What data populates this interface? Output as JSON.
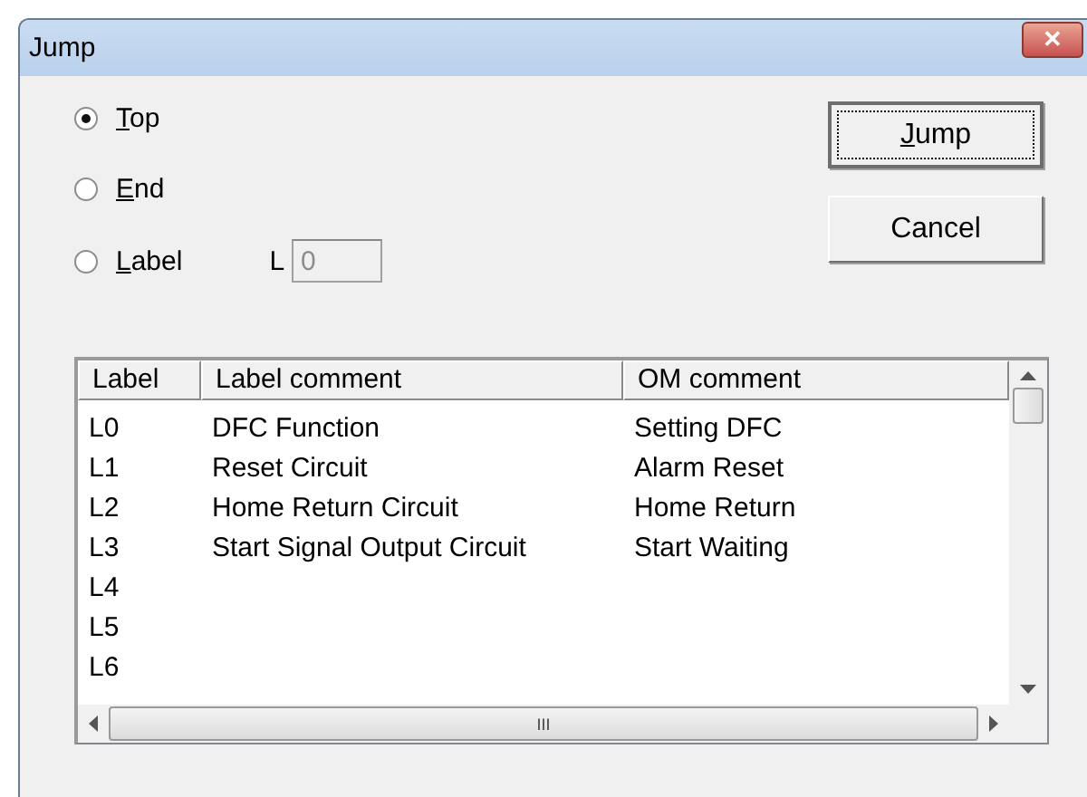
{
  "window": {
    "title": "Jump",
    "close": "✕"
  },
  "options": [
    {
      "label": "Top",
      "mnemonic": true,
      "selected": true
    },
    {
      "label": "End",
      "mnemonic": true,
      "selected": false
    },
    {
      "label": "Label",
      "mnemonic": true,
      "selected": false
    }
  ],
  "label_field": {
    "prefix": "L",
    "value": "0",
    "disabled": true
  },
  "buttons": [
    {
      "label": "Jump",
      "mnemonic": true,
      "focused": true
    },
    {
      "label": "Cancel",
      "mnemonic": false,
      "focused": false
    }
  ],
  "table": {
    "columns": [
      "Label",
      "Label comment",
      "OM comment"
    ],
    "rows": [
      [
        "L0",
        "DFC Function",
        "Setting DFC"
      ],
      [
        "L1",
        "Reset Circuit",
        "Alarm Reset"
      ],
      [
        "L2",
        "Home Return Circuit",
        "Home Return"
      ],
      [
        "L3",
        "Start Signal Output Circuit",
        "Start Waiting"
      ],
      [
        "L4"
      ],
      [
        "L5"
      ],
      [
        "L6"
      ]
    ],
    "hscroll_grip": "III"
  }
}
